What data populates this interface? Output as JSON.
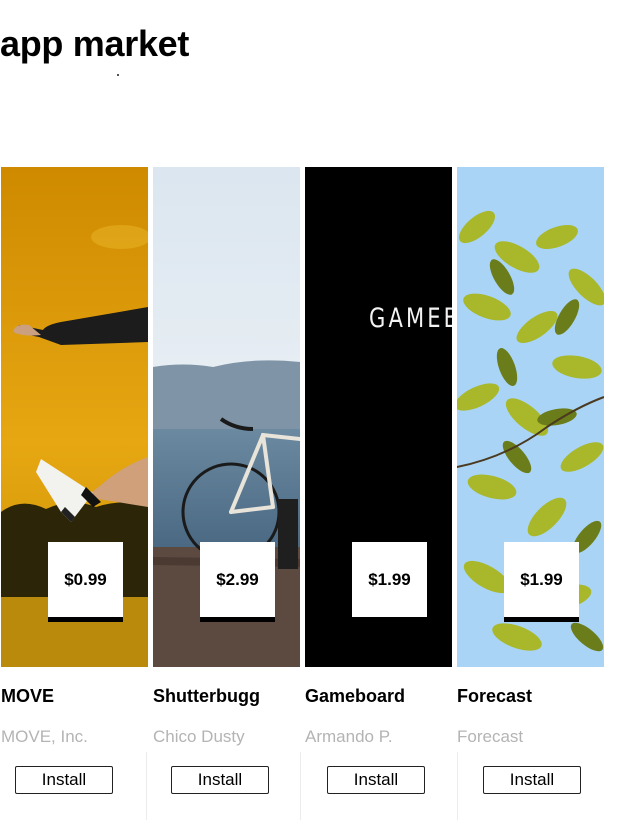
{
  "header": {
    "title": "app market"
  },
  "apps": [
    {
      "name": "MOVE",
      "developer": "MOVE, Inc.",
      "price": "$0.99",
      "install_label": "Install"
    },
    {
      "name": "Shutterbugg",
      "developer": "Chico Dusty",
      "price": "$2.99",
      "install_label": "Install"
    },
    {
      "name": "Gameboard",
      "developer": "Armando P.",
      "price": "$1.99",
      "install_label": "Install",
      "hero_text": "GAMEB"
    },
    {
      "name": "Forecast",
      "developer": "Forecast",
      "price": "$1.99",
      "install_label": "Install"
    }
  ],
  "colors": {
    "developer_text": "#b4b4b4",
    "move_hero": "#e2a10f",
    "gameboard_hero": "#000000",
    "sky": "#a9d4f5"
  },
  "icons": [
    "move-photo",
    "bicycle-photo",
    "gameboard-logo",
    "leaves-photo"
  ]
}
